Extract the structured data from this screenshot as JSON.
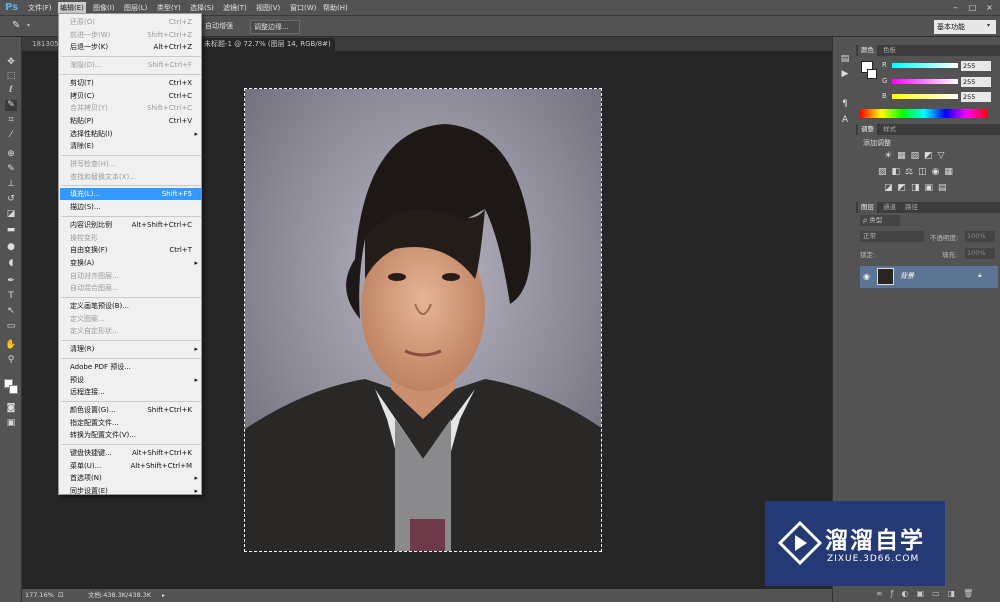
{
  "app": {
    "logo": "Ps"
  },
  "menubar": {
    "items": [
      "文件(F)",
      "编辑(E)",
      "图像(I)",
      "图层(L)",
      "类型(Y)",
      "选择(S)",
      "滤镜(T)",
      "视图(V)",
      "窗口(W)",
      "帮助(H)"
    ],
    "active": "编辑(E)"
  },
  "window_controls": [
    "–",
    "□",
    "×"
  ],
  "options": {
    "auto_enhance": "自动增强",
    "refine_edge": "调整边缘...",
    "workspace": "基本功能"
  },
  "document": {
    "tab_left": "1813050",
    "tab_title": "未标题-1 @ 72.7% (图层 14, RGB/8#)",
    "tab_close": "×"
  },
  "status": {
    "zoom": "177.16%",
    "doc_info": "文档:438.3K/438.3K"
  },
  "edit_menu": [
    {
      "label": "还原(O)",
      "shortcut": "Ctrl+Z",
      "disabled": true
    },
    {
      "label": "前进一步(W)",
      "shortcut": "Shift+Ctrl+Z",
      "disabled": true
    },
    {
      "label": "后退一步(K)",
      "shortcut": "Alt+Ctrl+Z",
      "disabled": false
    },
    {
      "sep": true
    },
    {
      "label": "渐隐(D)...",
      "shortcut": "Shift+Ctrl+F",
      "disabled": true
    },
    {
      "sep": true
    },
    {
      "label": "剪切(T)",
      "shortcut": "Ctrl+X",
      "disabled": false
    },
    {
      "label": "拷贝(C)",
      "shortcut": "Ctrl+C",
      "disabled": false
    },
    {
      "label": "合并拷贝(Y)",
      "shortcut": "Shift+Ctrl+C",
      "disabled": true
    },
    {
      "label": "粘贴(P)",
      "shortcut": "Ctrl+V",
      "disabled": false
    },
    {
      "label": "选择性粘贴(I)",
      "shortcut": "",
      "sub": true,
      "disabled": false
    },
    {
      "label": "清除(E)",
      "shortcut": "",
      "disabled": false
    },
    {
      "sep": true
    },
    {
      "label": "拼写检查(H)...",
      "shortcut": "",
      "disabled": true
    },
    {
      "label": "查找和替换文本(X)...",
      "shortcut": "",
      "disabled": true
    },
    {
      "sep": true
    },
    {
      "label": "填充(L)...",
      "shortcut": "Shift+F5",
      "highlight": true
    },
    {
      "label": "描边(S)...",
      "shortcut": "",
      "disabled": false
    },
    {
      "sep": true
    },
    {
      "label": "内容识别比例",
      "shortcut": "Alt+Shift+Ctrl+C",
      "disabled": false
    },
    {
      "label": "操控变形",
      "shortcut": "",
      "disabled": true
    },
    {
      "label": "自由变换(F)",
      "shortcut": "Ctrl+T",
      "disabled": false
    },
    {
      "label": "变换(A)",
      "shortcut": "",
      "sub": true,
      "disabled": false
    },
    {
      "label": "自动对齐图层...",
      "shortcut": "",
      "disabled": true
    },
    {
      "label": "自动混合图层...",
      "shortcut": "",
      "disabled": true
    },
    {
      "sep": true
    },
    {
      "label": "定义画笔预设(B)...",
      "shortcut": "",
      "disabled": false
    },
    {
      "label": "定义图案...",
      "shortcut": "",
      "disabled": true
    },
    {
      "label": "定义自定形状...",
      "shortcut": "",
      "disabled": true
    },
    {
      "sep": true
    },
    {
      "label": "清理(R)",
      "shortcut": "",
      "sub": true,
      "disabled": false
    },
    {
      "sep": true
    },
    {
      "label": "Adobe PDF 预设...",
      "shortcut": "",
      "disabled": false
    },
    {
      "label": "预设",
      "shortcut": "",
      "sub": true,
      "disabled": false
    },
    {
      "label": "远程连接...",
      "shortcut": "",
      "disabled": false
    },
    {
      "sep": true
    },
    {
      "label": "颜色设置(G)...",
      "shortcut": "Shift+Ctrl+K",
      "disabled": false
    },
    {
      "label": "指定配置文件...",
      "shortcut": "",
      "disabled": false
    },
    {
      "label": "转换为配置文件(V)...",
      "shortcut": "",
      "disabled": false
    },
    {
      "sep": true
    },
    {
      "label": "键盘快捷键...",
      "shortcut": "Alt+Shift+Ctrl+K",
      "disabled": false
    },
    {
      "label": "菜单(U)...",
      "shortcut": "Alt+Shift+Ctrl+M",
      "disabled": false
    },
    {
      "label": "首选项(N)",
      "shortcut": "",
      "sub": true,
      "disabled": false
    },
    {
      "label": "同步设置(E)",
      "shortcut": "",
      "sub": true,
      "disabled": false
    }
  ],
  "color_panel": {
    "tabs": [
      "颜色",
      "色板"
    ],
    "channels": [
      {
        "label": "R",
        "value": "255"
      },
      {
        "label": "G",
        "value": "255"
      },
      {
        "label": "B",
        "value": "255"
      }
    ]
  },
  "adjustments_panel": {
    "tabs": [
      "调整",
      "样式"
    ],
    "title": "添加调整"
  },
  "layers_panel": {
    "tabs": [
      "图层",
      "通道",
      "路径"
    ],
    "kind": "ρ 类型",
    "blend_mode": "正常",
    "opacity_label": "不透明度:",
    "opacity_value": "100%",
    "lock_label": "锁定:",
    "fill_label": "填充:",
    "fill_value": "100%",
    "layer_name": "背景"
  },
  "watermark": {
    "brand": "溜溜自学",
    "url": "ZIXUE.3D66.COM"
  },
  "colors": {
    "ui_dark": "#535353",
    "highlight": "#3399ff",
    "layer_selected": "#5c7595",
    "watermark_bg": "#253a75"
  }
}
